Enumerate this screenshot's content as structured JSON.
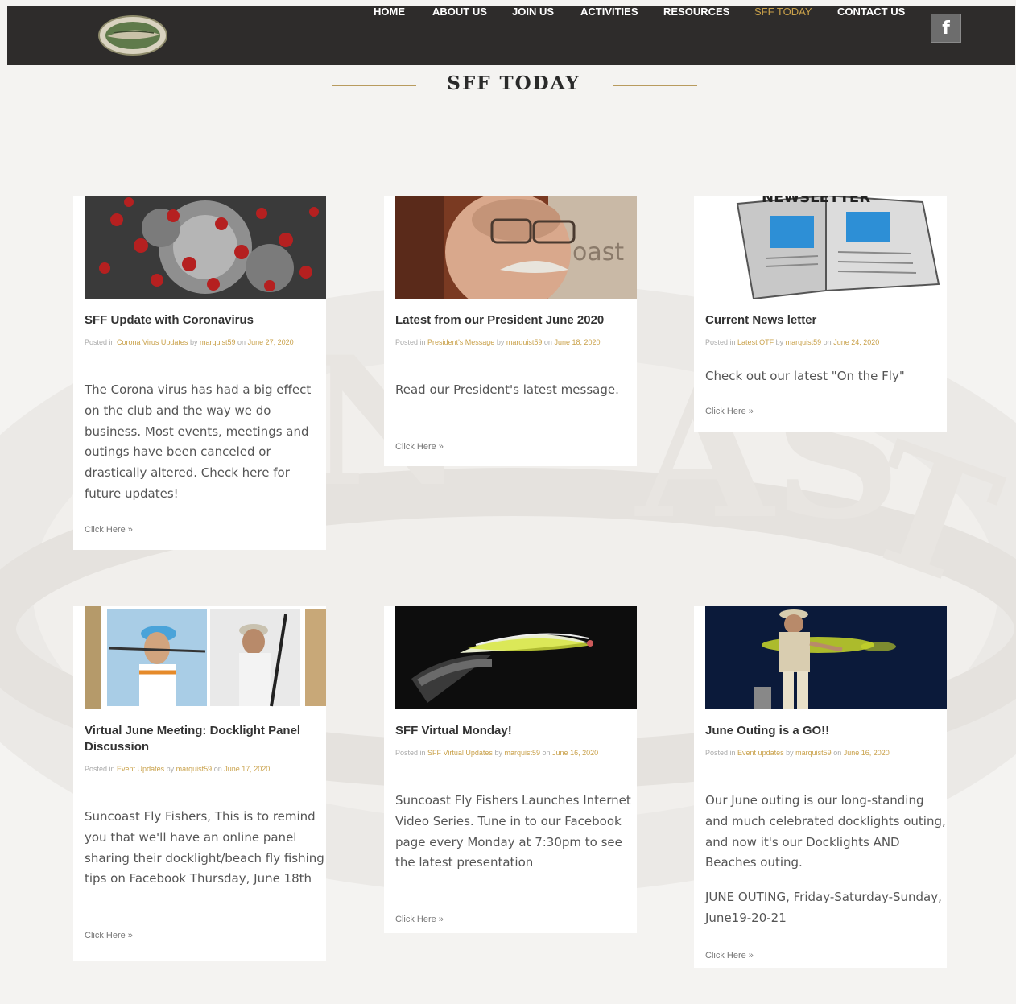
{
  "nav": {
    "items": [
      {
        "label": "HOME"
      },
      {
        "label": "ABOUT US"
      },
      {
        "label": "JOIN US"
      },
      {
        "label": "ACTIVITIES"
      },
      {
        "label": "RESOURCES"
      },
      {
        "label": "SFF TODAY"
      },
      {
        "label": "CONTACT US"
      }
    ],
    "active": "SFF TODAY",
    "facebook_glyph": "f"
  },
  "page": {
    "title": "SFF TODAY"
  },
  "labels": {
    "posted_in": "Posted in",
    "by": "by",
    "on": "on"
  },
  "posts": [
    {
      "title": "SFF Update with Coronavirus",
      "category": "Corona Virus Updates",
      "author": "marquist59",
      "date": "June 27, 2020",
      "excerpt": "The Corona virus has had a big effect on the club and the way we do business. Most events, meetings and outings have been canceled or drastically altered. Check here for future updates!",
      "more": "Click Here »",
      "image": "coronavirus-image"
    },
    {
      "title": "Latest from our President June 2020",
      "category": "President's Message",
      "author": "marquist59",
      "date": "June 18, 2020",
      "excerpt": "Read our President's latest message.",
      "more": "Click Here »",
      "image": "president-photo"
    },
    {
      "title": "Current News letter",
      "category": "Latest OTF",
      "author": "marquist59",
      "date": "June 24, 2020",
      "excerpt": "Check out our latest \"On the Fly\"",
      "more": "Click Here »",
      "image": "newsletter-image"
    },
    {
      "title": "Virtual June Meeting: Docklight Panel Discussion",
      "category": "Event Updates",
      "author": "marquist59",
      "date": "June 17, 2020",
      "excerpt": "Suncoast Fly Fishers, This is to remind you that we'll have an online panel sharing their docklight/beach fly fishing tips on Facebook Thursday, June 18th",
      "more": "Click Here »",
      "image": "panel-photos"
    },
    {
      "title": "SFF Virtual Monday!",
      "category": "SFF Virtual Updates",
      "author": "marquist59",
      "date": "June 16, 2020",
      "excerpt": "Suncoast Fly Fishers Launches Internet Video Series. Tune in to our Facebook page every Monday at 7:30pm to see the latest presentation",
      "more": "Click Here »",
      "image": "fly-photo"
    },
    {
      "title": "June Outing is a GO!!",
      "category": "Event updates",
      "author": "marquist59",
      "date": "June 16, 2020",
      "excerpt": "Our June outing is our long-standing and much celebrated docklights outing, and now it's our Docklights AND Beaches outing.",
      "excerpt2": "JUNE OUTING, Friday-Saturday-Sunday, June19-20-21",
      "more": "Click Here »",
      "image": "docklight-photo"
    }
  ],
  "colors": {
    "nav_bg": "#2e2c2b",
    "accent": "#c9a14a",
    "page_bg": "#f4f3f1"
  }
}
